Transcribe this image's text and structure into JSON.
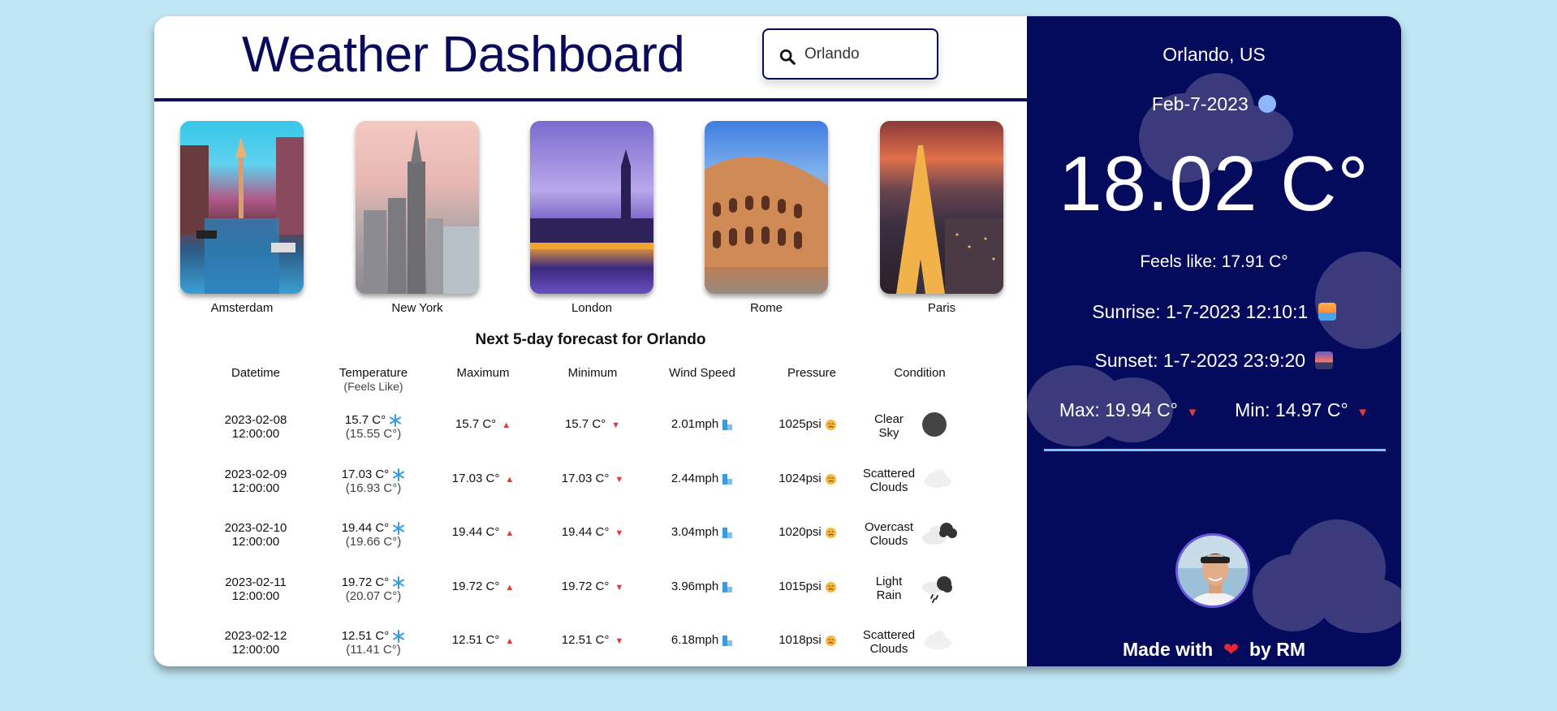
{
  "header": {
    "title": "Weather Dashboard",
    "search_value": "Orlando"
  },
  "cities": [
    {
      "name": "Amsterdam"
    },
    {
      "name": "New York"
    },
    {
      "name": "London"
    },
    {
      "name": "Rome"
    },
    {
      "name": "Paris"
    }
  ],
  "forecast": {
    "title": "Next 5-day forecast for Orlando",
    "columns": {
      "datetime": "Datetime",
      "temperature": "Temperature",
      "temperature_sub": "(Feels Like)",
      "maximum": "Maximum",
      "minimum": "Minimum",
      "wind": "Wind Speed",
      "pressure": "Pressure",
      "condition": "Condition"
    },
    "rows": [
      {
        "date": "2023-02-08",
        "time": "12:00:00",
        "temp": "15.7 C°",
        "feels": "(15.55 C°)",
        "max": "15.7 C°",
        "min": "15.7 C°",
        "wind": "2.01mph",
        "pressure": "1025psi",
        "cond1": "Clear",
        "cond2": "Sky",
        "icon": "clear-sky-icon"
      },
      {
        "date": "2023-02-09",
        "time": "12:00:00",
        "temp": "17.03 C°",
        "feels": "(16.93 C°)",
        "max": "17.03 C°",
        "min": "17.03 C°",
        "wind": "2.44mph",
        "pressure": "1024psi",
        "cond1": "Scattered",
        "cond2": "Clouds",
        "icon": "scattered-clouds-icon"
      },
      {
        "date": "2023-02-10",
        "time": "12:00:00",
        "temp": "19.44 C°",
        "feels": "(19.66 C°)",
        "max": "19.44 C°",
        "min": "19.44 C°",
        "wind": "3.04mph",
        "pressure": "1020psi",
        "cond1": "Overcast",
        "cond2": "Clouds",
        "icon": "overcast-clouds-icon"
      },
      {
        "date": "2023-02-11",
        "time": "12:00:00",
        "temp": "19.72 C°",
        "feels": "(20.07 C°)",
        "max": "19.72 C°",
        "min": "19.72 C°",
        "wind": "3.96mph",
        "pressure": "1015psi",
        "cond1": "Light",
        "cond2": "Rain",
        "icon": "light-rain-icon"
      },
      {
        "date": "2023-02-12",
        "time": "12:00:00",
        "temp": "12.51 C°",
        "feels": "(11.41 C°)",
        "max": "12.51 C°",
        "min": "12.51 C°",
        "wind": "6.18mph",
        "pressure": "1018psi",
        "cond1": "Scattered",
        "cond2": "Clouds",
        "icon": "scattered-clouds-icon"
      }
    ]
  },
  "current": {
    "location": "Orlando, US",
    "date": "Feb-7-2023",
    "temperature": "18.02 C°",
    "feels_like": "Feels like: 17.91 C°",
    "sunrise": "Sunrise: 1-7-2023 12:10:1",
    "sunset": "Sunset: 1-7-2023 23:9:20",
    "max": "Max: 19.94 C°",
    "min": "Min: 14.97 C°"
  },
  "footer": {
    "made_with": "Made with",
    "by": "by RM"
  },
  "colors": {
    "background": "#bfe6f3",
    "panel": "#040a5c",
    "accent": "#0a0a5a",
    "divider": "#7cc9ee",
    "arrow": "#e23a3a"
  }
}
